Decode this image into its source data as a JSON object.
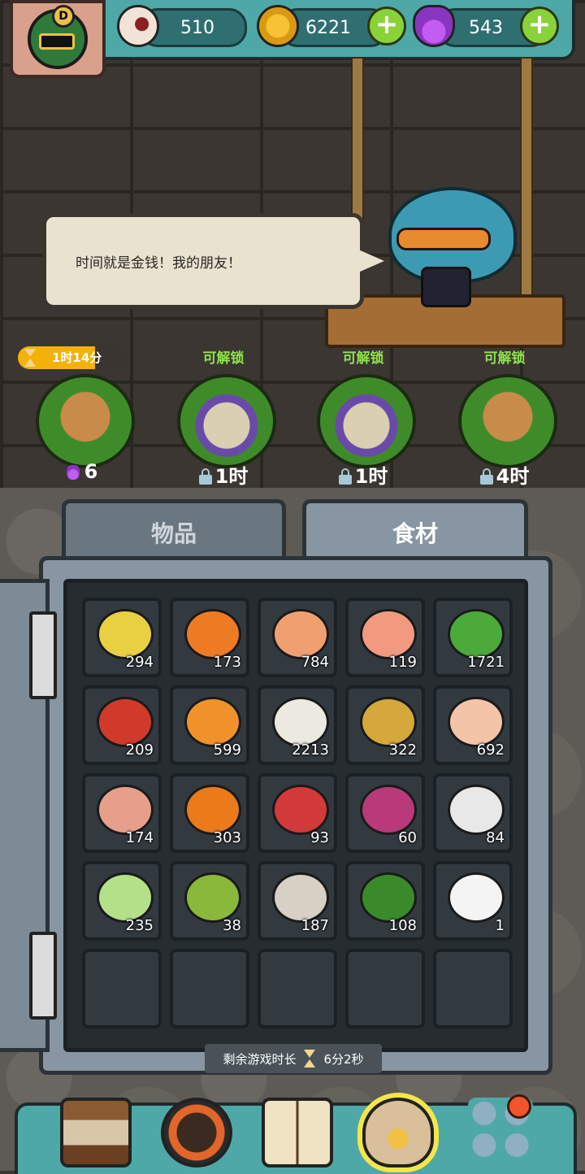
{
  "header": {
    "rank_badge": "D",
    "eyes": "510",
    "coins": "6221",
    "potions": "543"
  },
  "npc": {
    "speech": "时间就是金钱！我的朋友！"
  },
  "slots": [
    {
      "status": "",
      "timer": "1时14分",
      "cost": "6",
      "cost_icon": "potion-icon",
      "plant": "root-monster"
    },
    {
      "status": "可解锁",
      "timer": "",
      "cost": "1时",
      "cost_icon": "lock-icon",
      "plant": "egg-monster"
    },
    {
      "status": "可解锁",
      "timer": "",
      "cost": "1时",
      "cost_icon": "lock-icon",
      "plant": "egg-monster"
    },
    {
      "status": "可解锁",
      "timer": "",
      "cost": "4时",
      "cost_icon": "lock-icon",
      "plant": "root-monster"
    }
  ],
  "tabs": {
    "items": "物品",
    "ingredients": "食材"
  },
  "ingredients": [
    {
      "name": "corn",
      "qty": "294",
      "color": "#e9d043"
    },
    {
      "name": "carrot",
      "qty": "173",
      "color": "#ee7a24"
    },
    {
      "name": "egg",
      "qty": "784",
      "color": "#f0a070"
    },
    {
      "name": "salmon",
      "qty": "119",
      "color": "#f29a80"
    },
    {
      "name": "lettuce",
      "qty": "1721",
      "color": "#4caa3a"
    },
    {
      "name": "tomato",
      "qty": "209",
      "color": "#d03a2a"
    },
    {
      "name": "mushroom",
      "qty": "599",
      "color": "#f0922a"
    },
    {
      "name": "flour",
      "qty": "2213",
      "color": "#ece9e0"
    },
    {
      "name": "potato",
      "qty": "322",
      "color": "#d4a83a"
    },
    {
      "name": "chicken-leg",
      "qty": "692",
      "color": "#f4c4a8"
    },
    {
      "name": "ham",
      "qty": "174",
      "color": "#e6a08a"
    },
    {
      "name": "pumpkin",
      "qty": "303",
      "color": "#ea7a1a"
    },
    {
      "name": "steak",
      "qty": "93",
      "color": "#d23a3a"
    },
    {
      "name": "onion",
      "qty": "60",
      "color": "#b83a7a"
    },
    {
      "name": "milk",
      "qty": "84",
      "color": "#e8e8e8"
    },
    {
      "name": "cucumber",
      "qty": "235",
      "color": "#b4e08a"
    },
    {
      "name": "bitter-melon",
      "qty": "38",
      "color": "#8ab83a"
    },
    {
      "name": "oyster",
      "qty": "187",
      "color": "#d8d0c4"
    },
    {
      "name": "broccoli",
      "qty": "108",
      "color": "#3a8a2a"
    },
    {
      "name": "rice",
      "qty": "1",
      "color": "#f4f4f4"
    }
  ],
  "play_time": {
    "label": "剩余游戏时长",
    "value": "6分2秒"
  }
}
